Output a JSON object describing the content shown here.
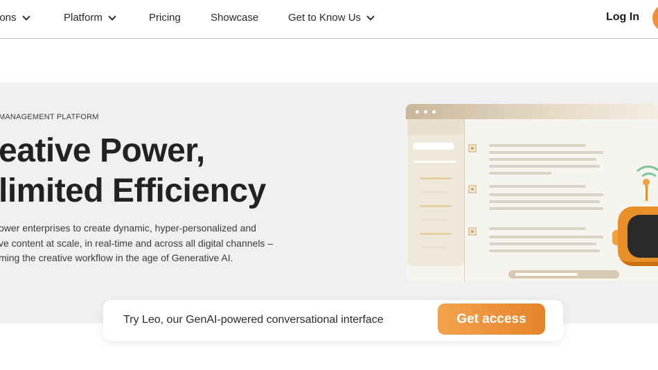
{
  "nav": {
    "items": [
      {
        "label": "ions",
        "has_dropdown": true
      },
      {
        "label": "Platform",
        "has_dropdown": true
      },
      {
        "label": "Pricing",
        "has_dropdown": false
      },
      {
        "label": "Showcase",
        "has_dropdown": false
      },
      {
        "label": "Get to Know Us",
        "has_dropdown": true
      }
    ],
    "login_label": "Log In"
  },
  "hero": {
    "eyebrow": "MANAGEMENT PLATFORM",
    "headline_line1": "eative Power,",
    "headline_line2": "limited Efficiency",
    "body_line1": "ower enterprises to create dynamic, hyper-personalized and",
    "body_line2": "ve content at scale, in real-time and across all digital channels –",
    "body_line3": "ming the creative workflow in the age of Generative AI."
  },
  "promo": {
    "text": "Try Leo, our GenAI-powered conversational interface",
    "button_label": "Get access"
  },
  "colors": {
    "accent": "#e88f2a",
    "hero_bg": "#f0f0f0",
    "nav_border": "#bdbdbd"
  },
  "icons": {
    "dropdown": "chevron-down-icon",
    "robot": "robot-mascot-icon",
    "signal": "wifi-icon"
  }
}
